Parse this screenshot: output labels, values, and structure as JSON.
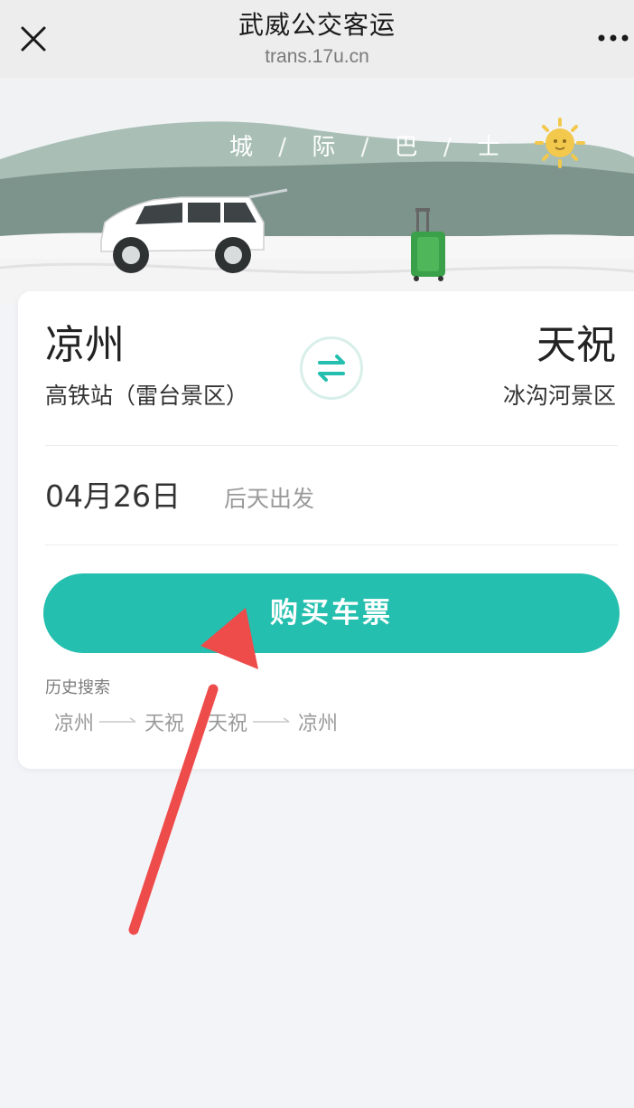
{
  "topbar": {
    "title": "武威公交客运",
    "subtitle": "trans.17u.cn"
  },
  "banner": {
    "text_chars": [
      "城",
      "际",
      "巴",
      "士"
    ]
  },
  "route": {
    "from_city": "凉州",
    "from_station": "高铁站（雷台景区）",
    "to_city": "天祝",
    "to_station": "冰沟河景区"
  },
  "date": {
    "value": "04月26日",
    "note": "后天出发"
  },
  "buy_button": {
    "label": "购买车票"
  },
  "history": {
    "label": "历史搜索",
    "items": [
      {
        "from": "凉州",
        "to": "天祝"
      },
      {
        "from": "天祝",
        "to": "凉州"
      }
    ]
  },
  "colors": {
    "accent": "#24bfae",
    "annotation_arrow": "#ee4b4b"
  }
}
